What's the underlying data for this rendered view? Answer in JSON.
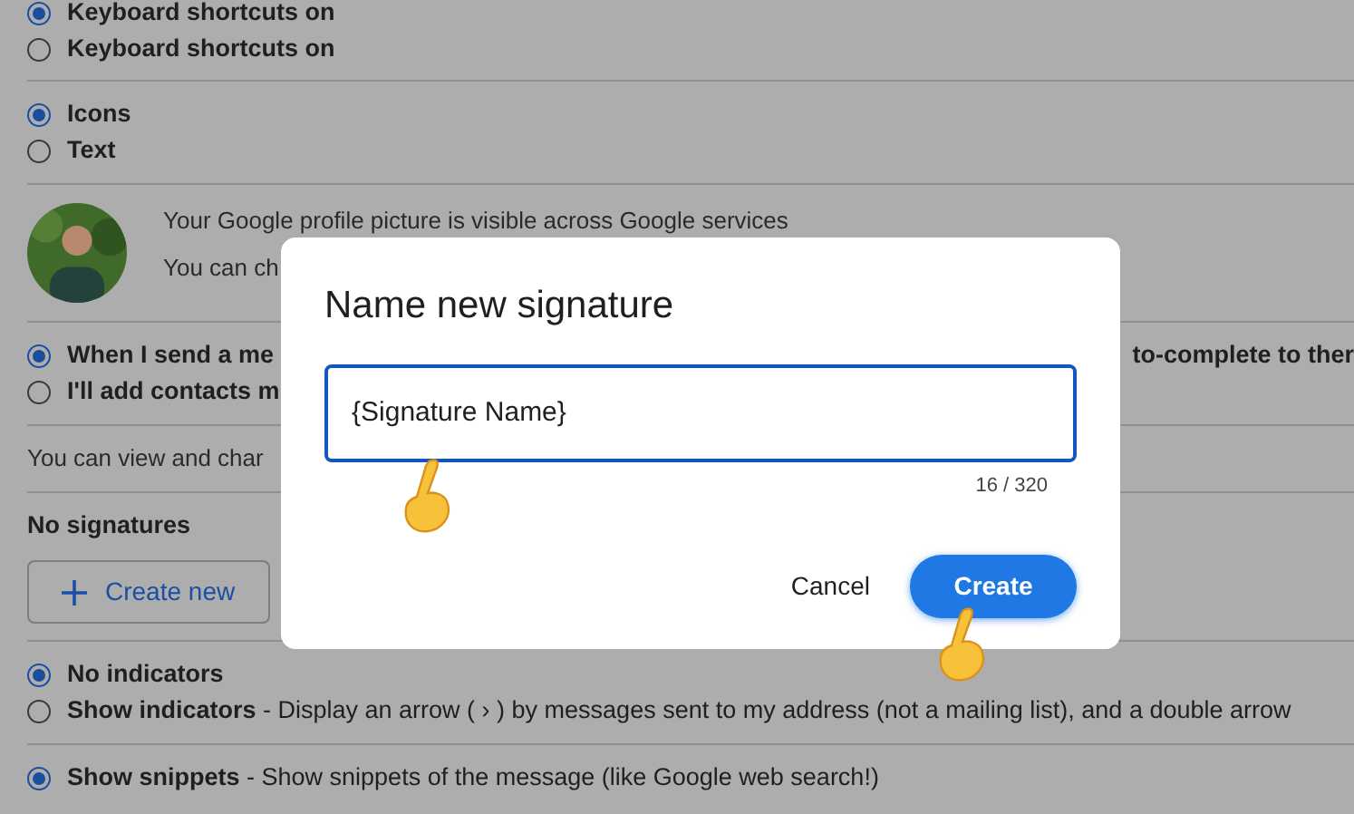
{
  "settings": {
    "sections": [
      {
        "kind": "radio_group",
        "options": [
          {
            "label": "Keyboard shortcuts on",
            "selected": true
          },
          {
            "label": "Keyboard shortcuts on",
            "selected": false
          }
        ]
      },
      {
        "kind": "radio_group",
        "options": [
          {
            "label": "Icons",
            "selected": true
          },
          {
            "label": "Text",
            "selected": false
          }
        ]
      },
      {
        "kind": "profile",
        "lines": [
          "Your Google profile picture is visible across Google services",
          "You can ch"
        ]
      },
      {
        "kind": "radio_group",
        "options": [
          {
            "label": "When I send a me",
            "trailing": "to-complete to ther",
            "selected": true
          },
          {
            "label": "I'll add contacts m",
            "selected": false
          }
        ]
      },
      {
        "kind": "text",
        "text": "You can view and char"
      },
      {
        "kind": "signatures",
        "heading": "No signatures",
        "button": "Create new"
      },
      {
        "kind": "radio_group",
        "options": [
          {
            "label": "No indicators",
            "selected": true
          },
          {
            "label": "**Show indicators** - Display an arrow ( › ) by messages sent to my address (not a mailing list), and a double arrow",
            "selected": false
          }
        ]
      },
      {
        "kind": "radio_group",
        "options": [
          {
            "label": "**Show snippets** - Show snippets of the message (like Google web search!)",
            "selected": true
          }
        ]
      }
    ]
  },
  "dialog": {
    "title": "Name new signature",
    "input": {
      "value": "{Signature Name}"
    },
    "counter": "16 / 320",
    "buttons": [
      {
        "label": "Cancel",
        "kind": "text"
      },
      {
        "label": "Create",
        "kind": "primary"
      }
    ]
  }
}
